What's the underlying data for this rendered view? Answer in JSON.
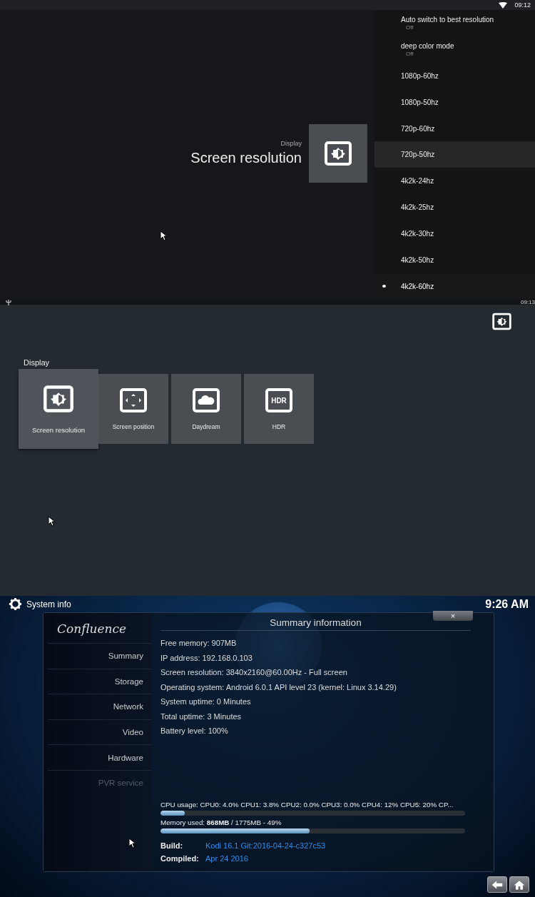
{
  "resolution_screen": {
    "status_bar": {
      "time": "09:12"
    },
    "breadcrumb": "Display",
    "title": "Screen resolution",
    "options": [
      {
        "label": "Auto switch to best resolution",
        "value": "Off",
        "focused": false,
        "selected": false
      },
      {
        "label": "deep color mode",
        "value": "Off",
        "focused": false,
        "selected": false
      },
      {
        "label": "1080p-60hz",
        "focused": false,
        "selected": false
      },
      {
        "label": "1080p-50hz",
        "focused": false,
        "selected": false
      },
      {
        "label": "720p-60hz",
        "focused": false,
        "selected": false
      },
      {
        "label": "720p-50hz",
        "focused": true,
        "selected": false
      },
      {
        "label": "4k2k-24hz",
        "focused": false,
        "selected": false
      },
      {
        "label": "4k2k-25hz",
        "focused": false,
        "selected": false
      },
      {
        "label": "4k2k-30hz",
        "focused": false,
        "selected": false
      },
      {
        "label": "4k2k-50hz",
        "focused": false,
        "selected": false
      },
      {
        "label": "4k2k-60hz",
        "focused": false,
        "selected": true
      }
    ]
  },
  "display_screen": {
    "status_bar": {
      "time": "09:13"
    },
    "heading": "Display",
    "tiles": [
      {
        "label": "Screen resolution",
        "kind": "brightness",
        "selected": true
      },
      {
        "label": "Screen position",
        "kind": "arrows",
        "selected": false
      },
      {
        "label": "Daydream",
        "kind": "cloud",
        "selected": false
      },
      {
        "label": "HDR",
        "kind": "hdr",
        "icon_text": "HDR",
        "selected": false
      }
    ]
  },
  "system_info": {
    "header": {
      "title": "System info",
      "clock": "9:26 AM"
    },
    "logo": "Confluence",
    "menu": [
      {
        "label": "Summary",
        "disabled": false
      },
      {
        "label": "Storage",
        "disabled": false
      },
      {
        "label": "Network",
        "disabled": false
      },
      {
        "label": "Video",
        "disabled": false
      },
      {
        "label": "Hardware",
        "disabled": false
      },
      {
        "label": "PVR service",
        "disabled": true
      }
    ],
    "dialog_title": "Summary information",
    "close": "×",
    "info_lines": [
      "Free memory: 907MB",
      "IP address: 192.168.0.103",
      "Screen resolution: 3840x2160@60.00Hz - Full screen",
      "Operating system: Android 6.0.1 API level 23 (kernel: Linux 3.14.29)",
      "System uptime: 0 Minutes",
      "Total uptime: 3 Minutes",
      "Battery level: 100%"
    ],
    "cpu": {
      "text": "CPU usage: CPU0: 4.0% CPU1: 3.8% CPU2: 0.0% CPU3: 0.0% CPU4:  12% CPU5:  20% CP...",
      "level": 0.08
    },
    "memory": {
      "text": "Memory used: **868MB** / 1775MB - 49%",
      "level": 0.49
    },
    "build": {
      "label": "Build:",
      "value": "Kodi 16.1 Git:2016-04-24-c327c53"
    },
    "compiled": {
      "label": "Compiled:",
      "value": "Apr 24 2016"
    }
  }
}
